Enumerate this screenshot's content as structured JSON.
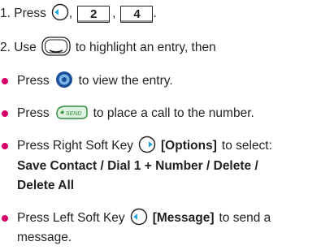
{
  "step1": {
    "text": "1. Press",
    "key1": "2",
    "key2": "4",
    "comma": ",",
    "end": "."
  },
  "step2": {
    "before": "2. Use",
    "after": "to highlight an entry, then"
  },
  "bullet1": {
    "before": "Press",
    "after": "to view the entry."
  },
  "bullet2": {
    "before": "Press",
    "after": "to place a call to the number.",
    "send_label": "SEND"
  },
  "bullet3": {
    "before": "Press Right Soft Key",
    "options": "[Options]",
    "after": "to select:",
    "choices_line1": "Save Contact / Dial 1 + Number / Delete /",
    "choices_line2": "Delete All"
  },
  "bullet4": {
    "before": "Press Left Soft Key",
    "message": "[Message]",
    "after": "to send a",
    "line2": "message."
  },
  "colors": {
    "bullet": "#d8006b",
    "text": "#231f20",
    "nav_key": "#1b4f9c"
  }
}
